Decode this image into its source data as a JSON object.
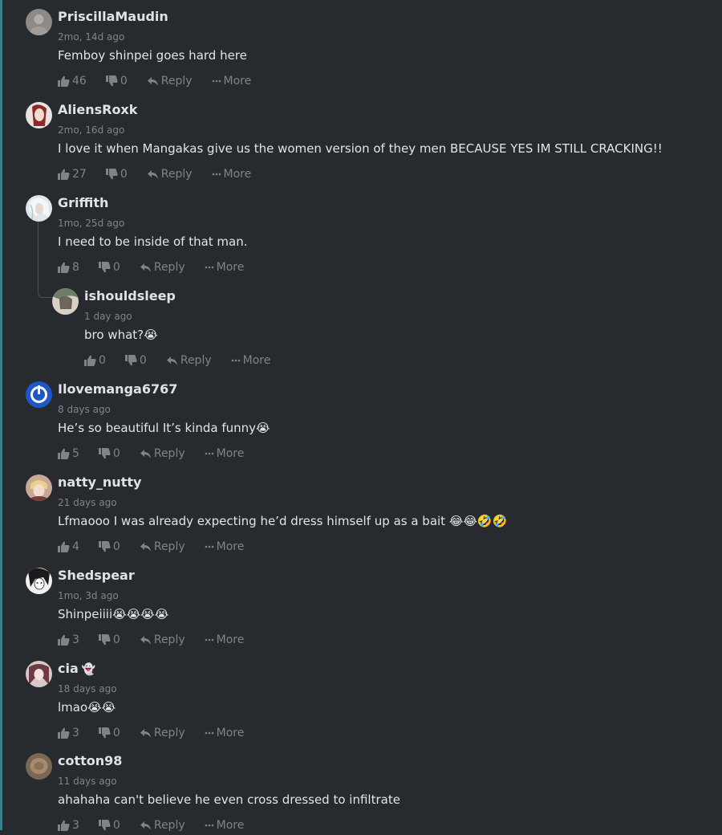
{
  "comments": [
    {
      "username": "PriscillaMaudin",
      "time": "2mo, 14d ago",
      "text": "Femboy shinpei goes hard here",
      "likes": "46",
      "dislikes": "0",
      "reply_label": "Reply",
      "more_label": "More"
    },
    {
      "username": "AliensRoxk",
      "time": "2mo, 16d ago",
      "text": "I love it when Mangakas give us the women version of they men BECAUSE YES IM STILL CRACKING!!",
      "likes": "27",
      "dislikes": "0",
      "reply_label": "Reply",
      "more_label": "More"
    },
    {
      "username": "Griffith",
      "time": "1mo, 25d ago",
      "text": "I need to be inside of that man.",
      "likes": "8",
      "dislikes": "0",
      "reply_label": "Reply",
      "more_label": "More"
    },
    {
      "username": "ishouldsleep",
      "time": "1 day ago",
      "text": "bro what?😭",
      "likes": "0",
      "dislikes": "0",
      "reply_label": "Reply",
      "more_label": "More"
    },
    {
      "username": "Ilovemanga6767",
      "time": "8 days ago",
      "text": "He’s so beautiful It’s kinda funny😭",
      "likes": "5",
      "dislikes": "0",
      "reply_label": "Reply",
      "more_label": "More"
    },
    {
      "username": "natty_nutty",
      "time": "21 days ago",
      "text": "Lfmaooo I was already expecting he’d dress himself up as a bait 😂😂🤣🤣",
      "likes": "4",
      "dislikes": "0",
      "reply_label": "Reply",
      "more_label": "More"
    },
    {
      "username": "Shedspear",
      "time": "1mo, 3d ago",
      "text": "Shinpeiiii😭😭😭😭",
      "likes": "3",
      "dislikes": "0",
      "reply_label": "Reply",
      "more_label": "More"
    },
    {
      "username": "cia",
      "username_suffix": "👻",
      "time": "18 days ago",
      "text": "lmao😭😭",
      "likes": "3",
      "dislikes": "0",
      "reply_label": "Reply",
      "more_label": "More"
    },
    {
      "username": "cotton98",
      "time": "11 days ago",
      "text": "ahahaha can't believe he even cross dressed to infiltrate",
      "likes": "3",
      "dislikes": "0",
      "reply_label": "Reply",
      "more_label": "More"
    }
  ],
  "colors": {
    "background": "#272a2e",
    "text": "#e2e5e7",
    "muted": "#7e8589",
    "rail": "#3a7f8a"
  },
  "icons": {
    "like": "thumbs-up-icon",
    "dislike": "thumbs-down-icon",
    "reply": "reply-arrow-icon",
    "more": "ellipsis-icon"
  }
}
